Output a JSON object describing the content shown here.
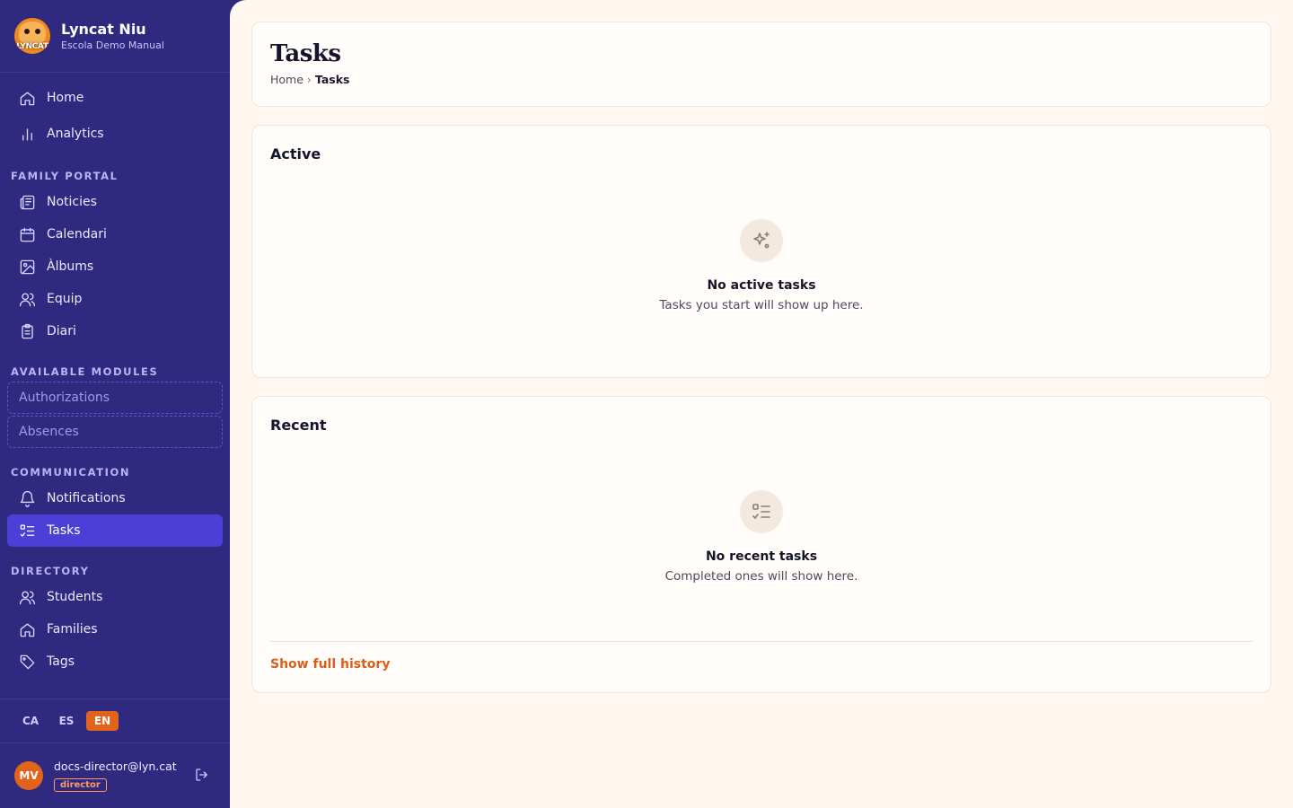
{
  "brand": {
    "logo_text": "LYNCAT",
    "name": "Lyncat Niu",
    "subtitle": "Escola Demo Manual"
  },
  "nav": {
    "top": [
      {
        "label": "Home",
        "icon": "home-icon"
      },
      {
        "label": "Analytics",
        "icon": "bar-chart-icon"
      }
    ],
    "sections": {
      "family_portal": "FAMILY PORTAL",
      "available_modules": "AVAILABLE MODULES",
      "communication": "COMMUNICATION",
      "directory": "DIRECTORY"
    },
    "family_portal": [
      {
        "label": "Noticies",
        "icon": "newspaper-icon"
      },
      {
        "label": "Calendari",
        "icon": "calendar-icon"
      },
      {
        "label": "Àlbums",
        "icon": "image-icon"
      },
      {
        "label": "Equip",
        "icon": "users-icon"
      },
      {
        "label": "Diari",
        "icon": "clipboard-icon"
      }
    ],
    "modules": [
      {
        "label": "Authorizations"
      },
      {
        "label": "Absences"
      }
    ],
    "communication": [
      {
        "label": "Notifications",
        "icon": "bell-icon"
      },
      {
        "label": "Tasks",
        "icon": "task-list-icon",
        "active": true
      }
    ],
    "directory": [
      {
        "label": "Students",
        "icon": "users-icon"
      },
      {
        "label": "Families",
        "icon": "home-icon"
      },
      {
        "label": "Tags",
        "icon": "tag-icon"
      }
    ]
  },
  "languages": [
    {
      "code": "CA"
    },
    {
      "code": "ES"
    },
    {
      "code": "EN",
      "active": true
    }
  ],
  "user": {
    "initials": "MV",
    "email": "docs-director@lyn.cat",
    "role": "director"
  },
  "page": {
    "title": "Tasks",
    "breadcrumb": {
      "home": "Home",
      "separator": "›",
      "current": "Tasks"
    }
  },
  "active": {
    "title": "Active",
    "empty_title": "No active tasks",
    "empty_sub": "Tasks you start will show up here.",
    "icon": "sparkles-icon"
  },
  "recent": {
    "title": "Recent",
    "empty_title": "No recent tasks",
    "empty_sub": "Completed ones will show here.",
    "icon": "task-list-icon",
    "history_link": "Show full history"
  },
  "colors": {
    "sidebar": "#2f2a80",
    "active_nav": "#4b3fd8",
    "accent": "#e2641c",
    "main_bg": "#fff7f0"
  }
}
